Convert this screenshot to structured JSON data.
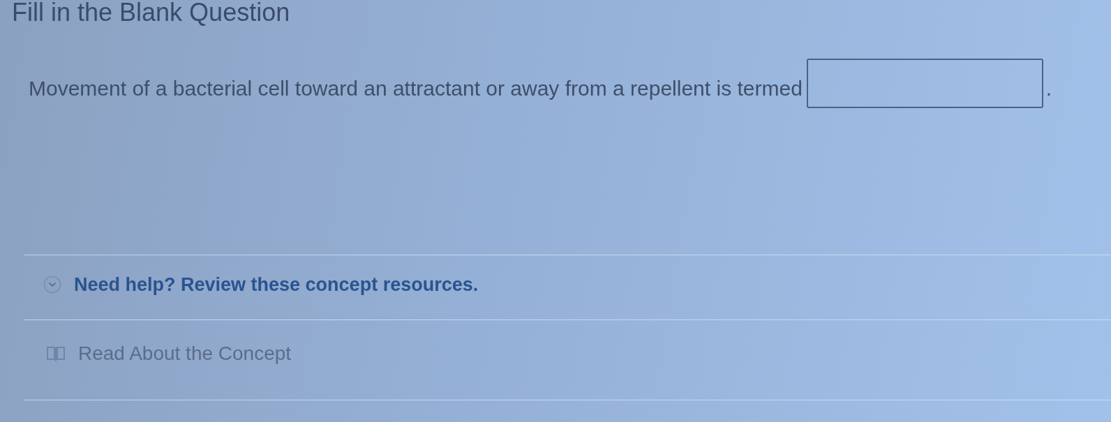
{
  "title": "Fill in the Blank Question",
  "question": {
    "parts": [
      {
        "kind": "text",
        "text": "Movement of a bacterial cell toward an attractant or away from a repellent is termed"
      },
      {
        "kind": "blank"
      },
      {
        "kind": "text",
        "text": "."
      }
    ]
  },
  "help": {
    "label": "Need help? Review these concept resources.",
    "expanded": true
  },
  "resources": [
    {
      "label": "Read About the Concept"
    }
  ]
}
